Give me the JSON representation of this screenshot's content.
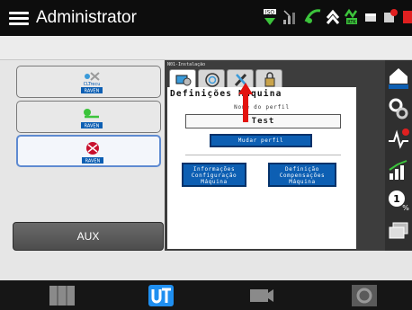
{
  "header": {
    "title": "Administrator",
    "status_icons": [
      "iso-badge-icon",
      "signal-icon",
      "gps-icon",
      "chevron-up-icon",
      "rtk-badge-icon",
      "window-icon",
      "alert-icon"
    ]
  },
  "left_panel": {
    "items": [
      {
        "name": "CLTrecu",
        "brand": "RAVEN"
      },
      {
        "name": "boom-implement",
        "brand": "RAVEN"
      },
      {
        "name": "field-computer",
        "brand": "RAVEN"
      }
    ],
    "aux_label": "AUX"
  },
  "vt": {
    "caption": "N01-Instalação",
    "tabs": [
      "machine-setup-icon",
      "target-icon",
      "wrench-screwdriver-icon",
      "lock-icon"
    ],
    "page_title": "Definições Máquina",
    "profile_label": "Nome do perfil",
    "profile_value": "Test",
    "change_profile_button": "Mudar perfil",
    "info_button": [
      "Informações",
      "Configuração",
      "Máquina"
    ],
    "comp_button": [
      "Definição",
      "Compensações",
      "Máquina"
    ]
  },
  "right_strip": {
    "icons": [
      "raven-home-icon",
      "gears-icon",
      "diagnostics-icon",
      "chart-icon",
      "number-percent-icon",
      "screens-icon"
    ]
  },
  "bottom_bar": {
    "icons": [
      "map-icon",
      "ut-icon",
      "camera-icon",
      "settings-gear-icon"
    ],
    "active": "ut-icon"
  },
  "colors": {
    "accent_blue": "#0d5fb3",
    "highlight_arrow": "#e3130f",
    "ut_blue": "#1f8ff0"
  }
}
